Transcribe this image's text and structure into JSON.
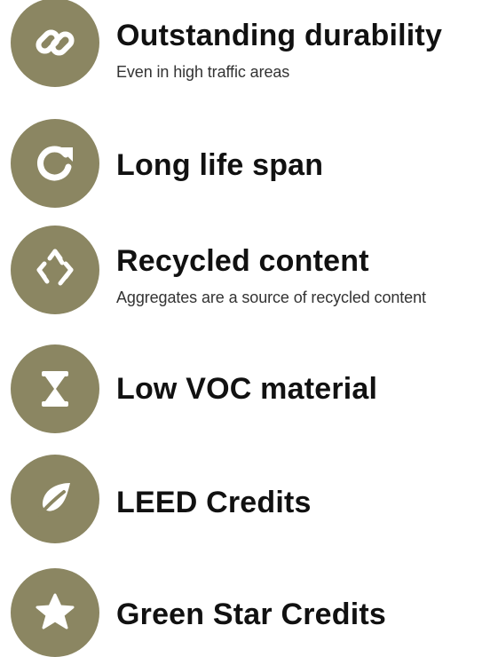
{
  "theme": {
    "icon_bg": "#8b8662",
    "icon_fg": "#ffffff",
    "title_color": "#111111",
    "subtitle_color": "#333333"
  },
  "features": [
    {
      "icon": "link-icon",
      "title": "Outstanding durability",
      "subtitle": "Even in high traffic areas"
    },
    {
      "icon": "refresh-icon",
      "title": "Long life span",
      "subtitle": ""
    },
    {
      "icon": "recycle-icon",
      "title": "Recycled content",
      "subtitle": "Aggregates are a source of recycled content"
    },
    {
      "icon": "hourglass-icon",
      "title": "Low VOC material",
      "subtitle": ""
    },
    {
      "icon": "leaf-icon",
      "title": "LEED Credits",
      "subtitle": ""
    },
    {
      "icon": "star-icon",
      "title": "Green Star Credits",
      "subtitle": ""
    }
  ]
}
